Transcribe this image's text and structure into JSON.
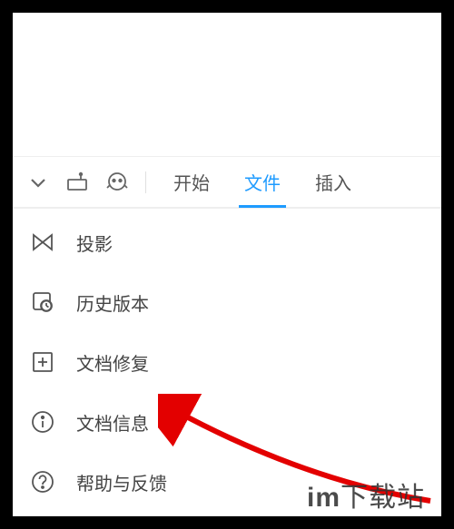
{
  "toolbar": {
    "tabs": [
      {
        "label": "开始",
        "active": false
      },
      {
        "label": "文件",
        "active": true
      },
      {
        "label": "插入",
        "active": false
      }
    ]
  },
  "menu": {
    "items": [
      {
        "icon": "projection-icon",
        "label": "投影"
      },
      {
        "icon": "history-icon",
        "label": "历史版本"
      },
      {
        "icon": "repair-icon",
        "label": "文档修复"
      },
      {
        "icon": "info-icon",
        "label": "文档信息"
      },
      {
        "icon": "help-icon",
        "label": "帮助与反馈"
      }
    ]
  },
  "watermark": {
    "text_strong": "im",
    "text_light": "下载站"
  },
  "annotation": {
    "type": "arrow",
    "points_to": "文档信息",
    "color": "#e30000"
  }
}
